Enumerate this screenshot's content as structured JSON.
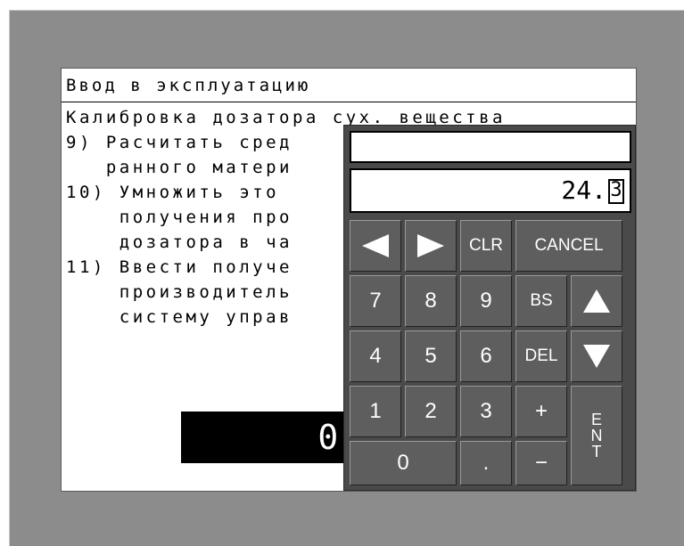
{
  "screen": {
    "title": "Ввод в эксплуатацию",
    "lines": [
      "Калибровка дозатора сух. вещества",
      "9) Расчитать сред",
      "   ранного матери",
      "10) Умножить это ",
      "    получения про",
      "    дозатора в ча",
      "11) Ввести получе",
      "    производитель",
      "    систему управ"
    ],
    "value_display": "0.0"
  },
  "keypad": {
    "input_value": "24.",
    "cursor_char": "3",
    "keys": {
      "left": "left-arrow",
      "right": "right-arrow",
      "clr": "CLR",
      "cancel": "CANCEL",
      "k7": "7",
      "k8": "8",
      "k9": "9",
      "bs": "BS",
      "up": "up-arrow",
      "k4": "4",
      "k5": "5",
      "k6": "6",
      "del": "DEL",
      "down": "down-arrow",
      "k1": "1",
      "k2": "2",
      "k3": "3",
      "plus": "+",
      "ent": [
        "E",
        "N",
        "T"
      ],
      "k0": "0",
      "dot": ".",
      "minus": "−"
    }
  }
}
